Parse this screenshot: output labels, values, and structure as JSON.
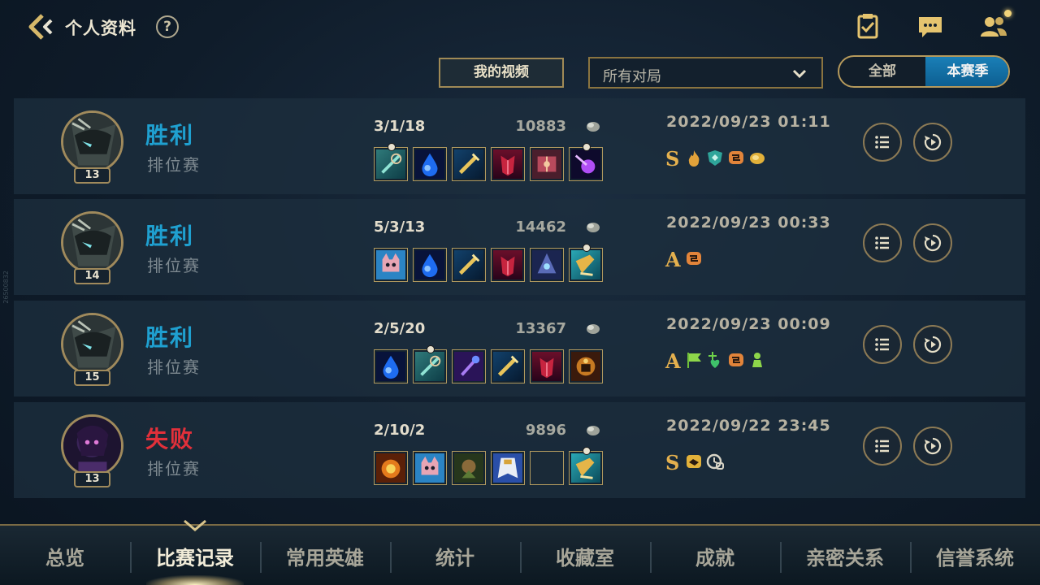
{
  "header": {
    "title": "个人资料",
    "help_label": "?",
    "icons": [
      "back-arrow-icon",
      "help-icon",
      "clipboard-check-icon",
      "chat-bubble-icon",
      "friends-icon"
    ]
  },
  "filters": {
    "video_button": "我的视频",
    "match_select": "所有对局",
    "season_toggle": {
      "all": "全部",
      "current": "本赛季",
      "selected": "本赛季"
    }
  },
  "side_id": "26500832",
  "matches": [
    {
      "result": "胜利",
      "outcome": "win",
      "mode": "排位赛",
      "level": "13",
      "kda": "3/1/18",
      "gold": "10883",
      "datetime": "2022/09/23 01:11",
      "grade": "S",
      "badges": [
        "fire-icon",
        "shield-icon",
        "link-icon",
        "coin-icon"
      ],
      "items": [
        "teal-sword-item",
        "blue-drop-item",
        "gold-sword-item",
        "red-armor-item",
        "book-item",
        "purple-orb-item"
      ]
    },
    {
      "result": "胜利",
      "outcome": "win",
      "mode": "排位赛",
      "level": "14",
      "kda": "5/3/13",
      "gold": "14462",
      "datetime": "2022/09/23 00:33",
      "grade": "A",
      "badges": [
        "link-icon"
      ],
      "items": [
        "cat-face-item",
        "blue-drop-item",
        "gold-sword-item",
        "red-armor-item",
        "blue-hood-item",
        "gold-pick-item"
      ]
    },
    {
      "result": "胜利",
      "outcome": "win",
      "mode": "排位赛",
      "level": "15",
      "kda": "2/5/20",
      "gold": "13367",
      "datetime": "2022/09/23 00:09",
      "grade": "A",
      "badges": [
        "flag-icon",
        "heal-icon",
        "link-icon",
        "pawn-icon"
      ],
      "items": [
        "blue-drop-item",
        "teal-sword-item",
        "purple-staff-item",
        "gold-sword-item",
        "red-armor-item",
        "golden-golem-item"
      ]
    },
    {
      "result": "失败",
      "outcome": "loss",
      "mode": "排位赛",
      "level": "13",
      "kda": "2/10/2",
      "gold": "9896",
      "datetime": "2022/09/22 23:45",
      "grade": "S",
      "badges": [
        "handshake-icon",
        "clock-link-icon"
      ],
      "items": [
        "fire-beast-item",
        "cat-face-item",
        "green-warrior-item",
        "white-cape-item",
        "empty-slot",
        "gold-pick-item"
      ]
    }
  ],
  "tabs": [
    "总览",
    "比赛记录",
    "常用英雄",
    "统计",
    "收藏室",
    "成就",
    "亲密关系",
    "信誉系统"
  ],
  "active_tab": "比赛记录",
  "colors": {
    "win": "#1fa0d0",
    "loss": "#e2303a",
    "gold_accent": "#b69a5c",
    "selected_blue": "#1a7fb7"
  }
}
